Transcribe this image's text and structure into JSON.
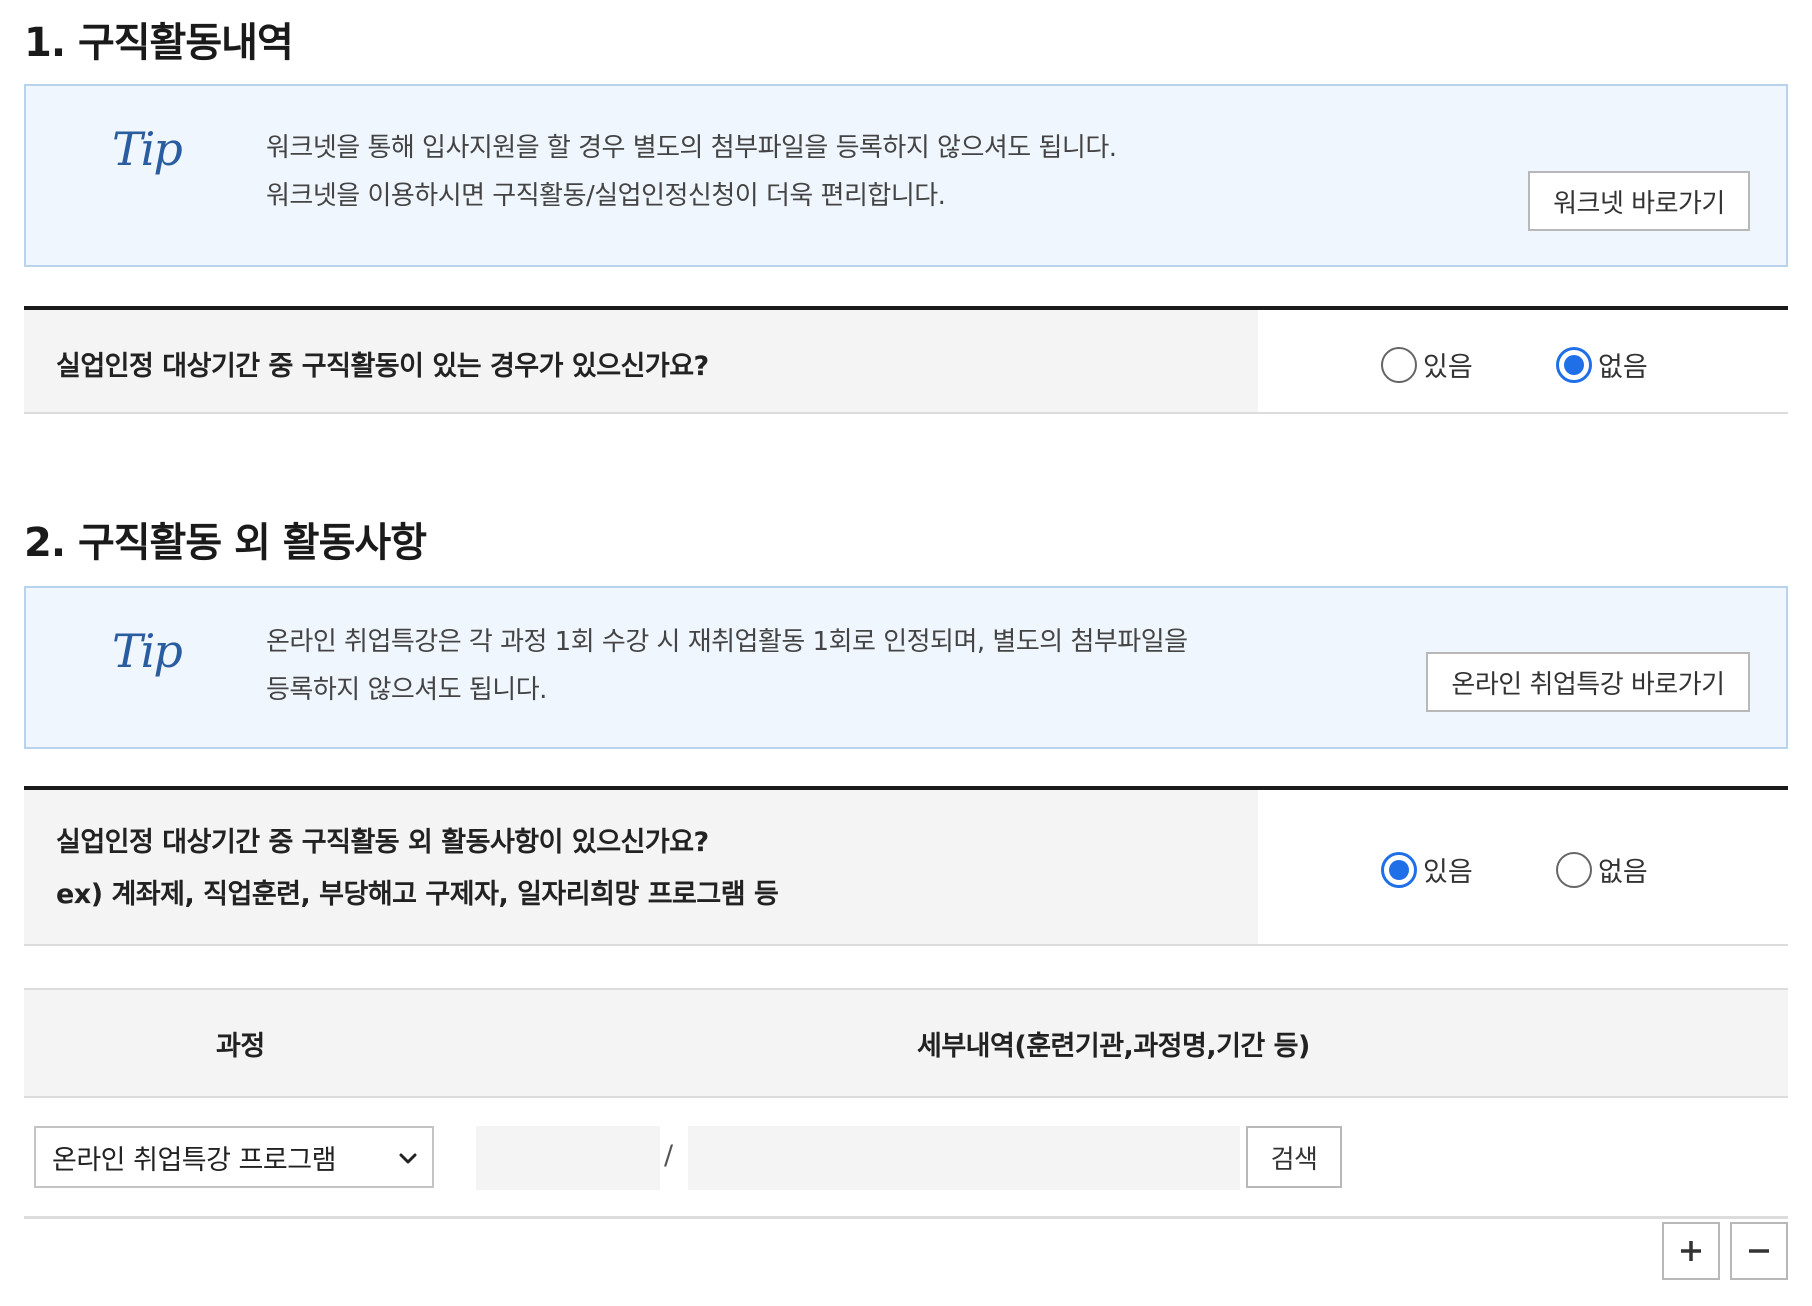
{
  "section1": {
    "title": "1. 구직활동내역",
    "tip_logo": "Tip",
    "tip_line1": "워크넷을 통해 입사지원을 할 경우 별도의 첨부파일을 등록하지 않으셔도 됩니다.",
    "tip_line2": "워크넷을 이용하시면 구직활동/실업인정신청이 더욱 편리합니다.",
    "link_button": "워크넷 바로가기",
    "question": "실업인정 대상기간 중 구직활동이 있는 경우가 있으신가요?",
    "options": [
      {
        "label": "있음",
        "selected": false
      },
      {
        "label": "없음",
        "selected": true
      }
    ]
  },
  "section2": {
    "title": "2. 구직활동 외 활동사항",
    "tip_logo": "Tip",
    "tip_line1": "온라인 취업특강은 각 과정 1회 수강 시 재취업활동 1회로 인정되며, 별도의 첨부파일을",
    "tip_line2": "등록하지 않으셔도 됩니다.",
    "link_button": "온라인 취업특강 바로가기",
    "question_line1": "실업인정 대상기간 중 구직활동 외 활동사항이 있으신가요?",
    "question_line2": "ex) 계좌제, 직업훈련, 부당해고 구제자, 일자리희망 프로그램 등",
    "options": [
      {
        "label": "있음",
        "selected": true
      },
      {
        "label": "없음",
        "selected": false
      }
    ]
  },
  "table": {
    "headers": [
      "과정",
      "세부내역(훈련기관,과정명,기간 등)"
    ],
    "row": {
      "course_selected": "온라인 취업특강 프로그램",
      "detail_1": "",
      "separator": "/",
      "detail_2": "",
      "search_button": "검색"
    }
  },
  "controls": {
    "add_symbol": "+",
    "remove_symbol": "−"
  },
  "colors": {
    "accent": "#1f6fe8",
    "tip_bg": "#f0f6fd",
    "tip_border": "#b9d3ec"
  }
}
